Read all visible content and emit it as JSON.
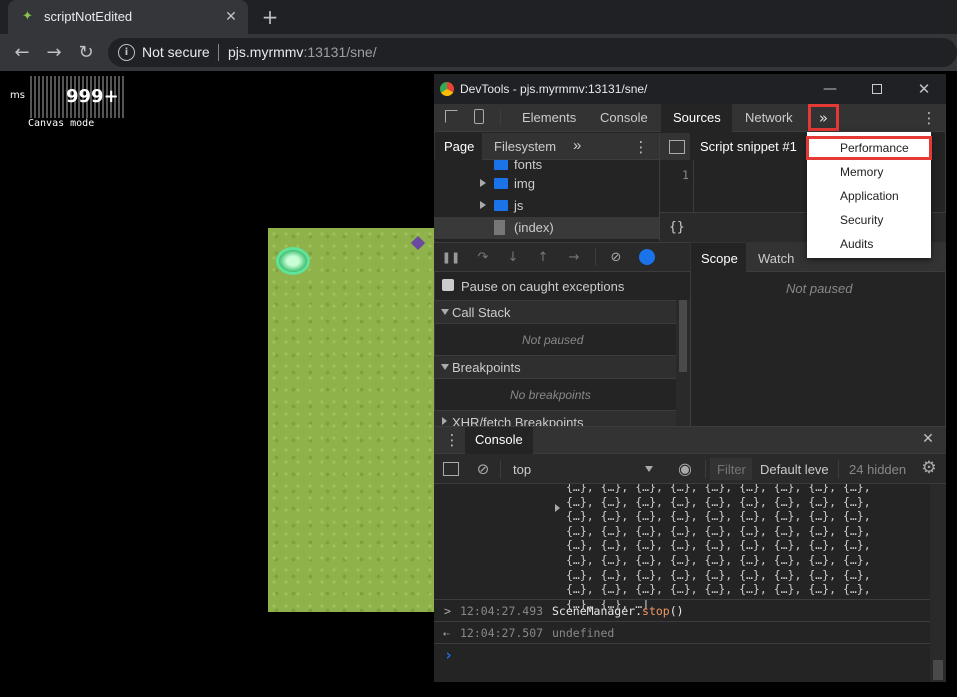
{
  "browser": {
    "tab_title": "scriptNotEdited",
    "security_label": "Not secure",
    "url_host": "pjs.myrmmv",
    "url_rest": ":13131/sne/"
  },
  "game": {
    "fps_unit": "ms",
    "fps_value": "999+",
    "mode_label": "Canvas mode"
  },
  "devtools": {
    "title": "DevTools - pjs.myrmmv:13131/sne/",
    "tabs": [
      "Elements",
      "Console",
      "Sources",
      "Network"
    ],
    "more_tabs_symbol": "»",
    "navigator_tabs": [
      "Page",
      "Filesystem"
    ],
    "tree": [
      "fonts",
      "img",
      "js",
      "(index)"
    ],
    "editor_tab": "Script snippet #1",
    "line_number": "1",
    "pretty_print": "{}",
    "scope_tabs": [
      "Scope",
      "Watch"
    ],
    "scope_status": "Not paused",
    "pause_exceptions": "Pause on caught exceptions",
    "call_stack": "Call Stack",
    "call_stack_status": "Not paused",
    "breakpoints": "Breakpoints",
    "breakpoints_status": "No breakpoints",
    "xhr_breakpoints": "XHR/fetch Breakpoints",
    "drawer_tab": "Console",
    "console_context": "top",
    "filter_placeholder": "Filter",
    "levels": "Default leve",
    "hidden_count": "24 hidden",
    "console_lines": [
      "{…}, {…}, {…}, {…}, {…}, {…}, {…}, {…}, {…},",
      "{…}, {…}, {…}, {…}, {…}, {…}, {…}, {…}, {…},",
      "{…}, {…}, {…}, {…}, {…}, {…}, {…}, {…}, {…},",
      "{…}, {…}, {…}, {…}, {…}, {…}, {…}, {…}, {…},",
      "{…}, {…}, {…}, {…}, {…}, {…}, {…}, {…}, {…},",
      "{…}, {…}, {…}, {…}, {…}, {…}, {…}, {…}, {…},",
      "{…}, {…}, {…}, {…}, {…}, {…}, {…}, {…}, {…},",
      "{…}, {…}, {…}, {…}, {…}, {…}, {…}, {…}, {…},",
      "{…}, {…}, …]"
    ],
    "cmd_time": "12:04:27.493",
    "cmd_obj": "SceneManager.",
    "cmd_method": "stop",
    "cmd_parens": "()",
    "result_time": "12:04:27.507",
    "result_value": "undefined",
    "prompt": "›"
  },
  "more_menu": [
    "Performance",
    "Memory",
    "Application",
    "Security",
    "Audits"
  ],
  "colors": {
    "highlight": "#e53935",
    "accent": "#1a73e8"
  }
}
